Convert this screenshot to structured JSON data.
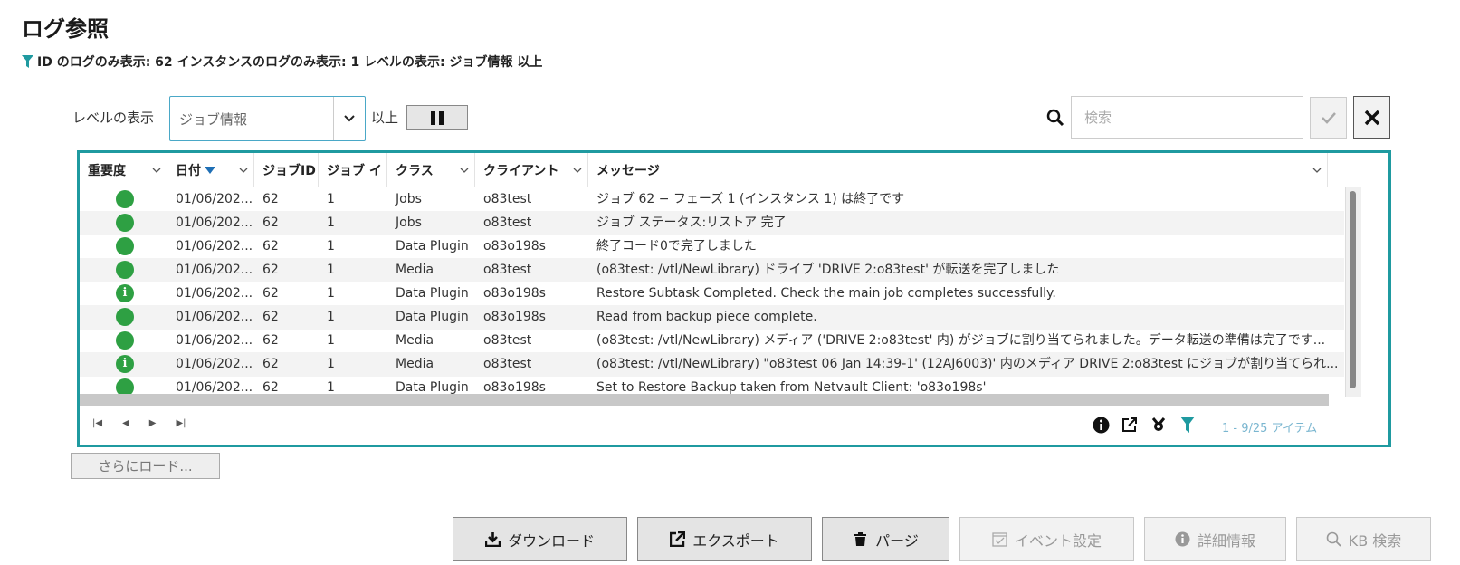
{
  "page": {
    "title": "ログ参照",
    "filter_summary": "ID のログのみ表示: 62  インスタンスのログのみ表示: 1  レベルの表示: ジョブ情報 以上"
  },
  "toolbar": {
    "level_label": "レベルの表示",
    "level_value": "ジョブ情報",
    "above_label": "以上",
    "search_placeholder": "検索"
  },
  "columns": {
    "severity": "重要度",
    "date": "日付",
    "job_id": "ジョブID",
    "job_instance": "ジョブ イ",
    "class": "クラス",
    "client": "クライアント",
    "message": "メッセージ"
  },
  "rows": [
    {
      "severity": "ok",
      "date": "01/06/202...",
      "job_id": "62",
      "instance": "1",
      "class": "Jobs",
      "client": "o83test",
      "message": "ジョブ 62 − フェーズ 1 (インスタンス 1) は終了です"
    },
    {
      "severity": "ok",
      "date": "01/06/202...",
      "job_id": "62",
      "instance": "1",
      "class": "Jobs",
      "client": "o83test",
      "message": "ジョブ ステータス:リストア 完了"
    },
    {
      "severity": "ok",
      "date": "01/06/202...",
      "job_id": "62",
      "instance": "1",
      "class": "Data Plugin",
      "client": "o83o198s",
      "message": "終了コード0で完了しました"
    },
    {
      "severity": "ok",
      "date": "01/06/202...",
      "job_id": "62",
      "instance": "1",
      "class": "Media",
      "client": "o83test",
      "message": "(o83test: /vtl/NewLibrary) ドライブ 'DRIVE 2:o83test' が転送を完了しました"
    },
    {
      "severity": "info",
      "date": "01/06/202...",
      "job_id": "62",
      "instance": "1",
      "class": "Data Plugin",
      "client": "o83o198s",
      "message": "Restore Subtask Completed. Check the main job completes successfully."
    },
    {
      "severity": "ok",
      "date": "01/06/202...",
      "job_id": "62",
      "instance": "1",
      "class": "Data Plugin",
      "client": "o83o198s",
      "message": "Read from backup piece complete."
    },
    {
      "severity": "ok",
      "date": "01/06/202...",
      "job_id": "62",
      "instance": "1",
      "class": "Media",
      "client": "o83test",
      "message": "(o83test: /vtl/NewLibrary) メディア ('DRIVE 2:o83test' 内) がジョブに割り当てられました。データ転送の準備は完了です..."
    },
    {
      "severity": "info",
      "date": "01/06/202...",
      "job_id": "62",
      "instance": "1",
      "class": "Media",
      "client": "o83test",
      "message": "(o83test: /vtl/NewLibrary) \"o83test 06 Jan 14:39-1' (12AJ6003)' 内のメディア DRIVE 2:o83test にジョブが割り当てられ..."
    },
    {
      "severity": "ok",
      "date": "01/06/202...",
      "job_id": "62",
      "instance": "1",
      "class": "Data Plugin",
      "client": "o83o198s",
      "message": "Set to Restore Backup taken from Netvault Client: 'o83o198s'"
    }
  ],
  "footer": {
    "item_count": "1 - 9/25 アイテム",
    "load_more": "さらにロード..."
  },
  "actions": {
    "download": "ダウンロード",
    "export": "エクスポート",
    "purge": "パージ",
    "event_settings": "イベント設定",
    "details": "詳細情報",
    "kb_search": "KB 検索"
  },
  "colors": {
    "accent": "#1f9aa0",
    "severity_ok": "#2ea043",
    "count_text": "#7ab6d0"
  }
}
